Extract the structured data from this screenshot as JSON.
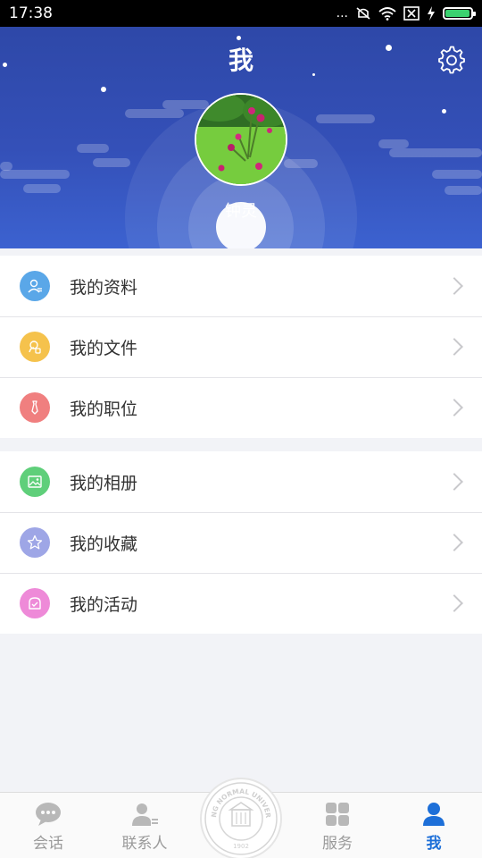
{
  "status_bar": {
    "time": "17:38",
    "dots": "...",
    "battery_level": 0.95
  },
  "header": {
    "title": "我",
    "username": "钟灵"
  },
  "menu_group_1": [
    {
      "label": "我的资料",
      "icon": "profile-icon",
      "color": "#5aa7e8"
    },
    {
      "label": "我的文件",
      "icon": "file-icon",
      "color": "#f5c24c"
    },
    {
      "label": "我的职位",
      "icon": "tie-icon",
      "color": "#f07f7f"
    }
  ],
  "menu_group_2": [
    {
      "label": "我的相册",
      "icon": "album-icon",
      "color": "#5fcf7a"
    },
    {
      "label": "我的收藏",
      "icon": "star-icon",
      "color": "#9ea6e6"
    },
    {
      "label": "我的活动",
      "icon": "activity-icon",
      "color": "#ee8ad8"
    }
  ],
  "tabbar": {
    "tabs": [
      {
        "label": "会话",
        "icon": "chat-icon"
      },
      {
        "label": "联系人",
        "icon": "contacts-icon"
      },
      {
        "label": "服务",
        "icon": "services-icon"
      },
      {
        "label": "我",
        "icon": "me-icon"
      }
    ],
    "active_tab": "我",
    "logo": {
      "text": "BEIJING NORMAL UNIVERSITY",
      "year": "1902"
    }
  },
  "colors": {
    "header": "#3450b8",
    "active_tab": "#1d6fd8",
    "background": "#f2f3f7"
  }
}
